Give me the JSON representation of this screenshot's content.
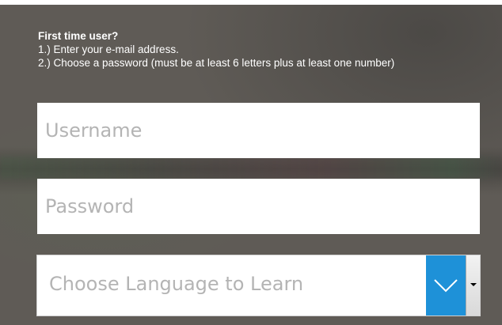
{
  "instructions": {
    "heading": "First time user?",
    "step1": "1.) Enter your e-mail address.",
    "step2": "2.) Choose a password (must be at least 6 letters plus at least one number)"
  },
  "form": {
    "username_placeholder": "Username",
    "password_placeholder": "Password",
    "language_select_value": "Choose Language to Learn"
  },
  "colors": {
    "dropdown_accent": "#1e91d8"
  },
  "icons": {
    "dropdown": "chevron-down-icon"
  }
}
